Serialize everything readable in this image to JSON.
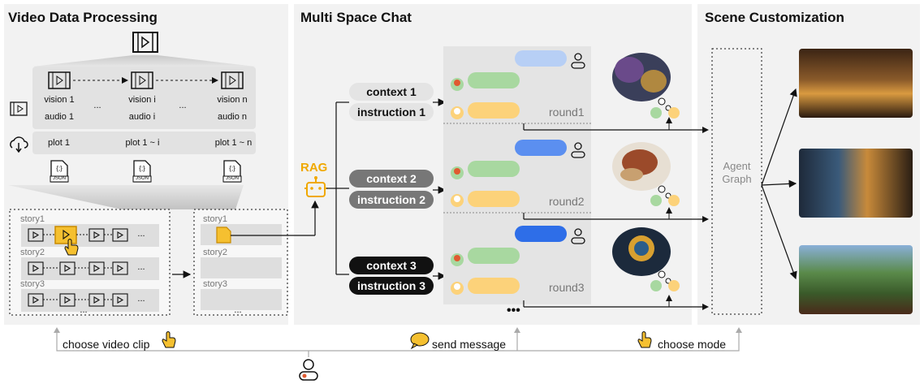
{
  "panels": {
    "video": {
      "title": "Video Data Processing"
    },
    "chat": {
      "title": "Multi Space Chat"
    },
    "scene": {
      "title": "Scene Customization"
    }
  },
  "video": {
    "clips": [
      {
        "vision": "vision 1",
        "audio": "audio 1"
      },
      {
        "vision": "vision i",
        "audio": "audio i"
      },
      {
        "vision": "vision n",
        "audio": "audio n"
      }
    ],
    "ellipsis": "...",
    "plots": [
      "plot 1",
      "plot 1 ~ i",
      "plot 1 ~ n"
    ],
    "json_label": "JSON",
    "json_brace": "{;}",
    "stories": [
      "story1",
      "story2",
      "story3"
    ],
    "more": "..."
  },
  "rag": {
    "label": "RAG"
  },
  "chat": {
    "contexts": [
      {
        "context": "context 1",
        "instruction": "instruction 1",
        "round": "round1"
      },
      {
        "context": "context 2",
        "instruction": "instruction 2",
        "round": "round2"
      },
      {
        "context": "context 3",
        "instruction": "instruction 3",
        "round": "round3"
      }
    ],
    "more": "•••"
  },
  "agent": {
    "line1": "Agent",
    "line2": "Graph"
  },
  "actions": {
    "choose_clip": "choose video clip",
    "send_message": "send message",
    "choose_mode": "choose mode"
  },
  "colors": {
    "panel_bg": "#f2f2f2",
    "green_bubble": "#a8d8a0",
    "yellow_bubble": "#fcd27a",
    "blue_light": "#b7cff5",
    "blue_mid": "#5b8ff0",
    "blue_dark": "#2e6ee8",
    "highlight": "#f5c030"
  }
}
